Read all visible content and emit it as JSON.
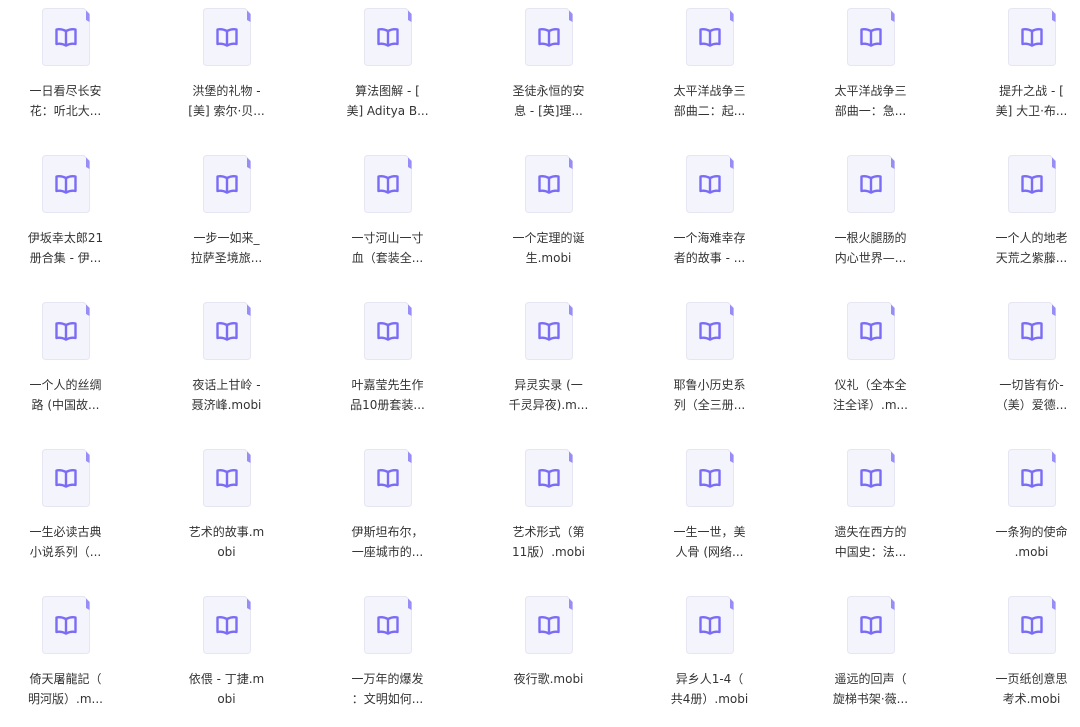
{
  "colors": {
    "icon_accent": "#7B6CF6",
    "icon_body": "#F4F4FD",
    "icon_border": "#E6E6F3",
    "icon_fold": "#8E82F5",
    "text": "#333333"
  },
  "icon": "ebook-book-icon",
  "files": [
    {
      "line1": "一日看尽长安",
      "line2": "花：听北大..."
    },
    {
      "line1": "洪堡的礼物 -",
      "line2": "[美] 索尔·贝..."
    },
    {
      "line1": "算法图解 - [",
      "line2": "美] Aditya B..."
    },
    {
      "line1": "圣徒永恒的安",
      "line2": "息 - [英]理..."
    },
    {
      "line1": "太平洋战争三",
      "line2": "部曲二：起..."
    },
    {
      "line1": "太平洋战争三",
      "line2": "部曲一：急..."
    },
    {
      "line1": "提升之战 - [",
      "line2": "美] 大卫·布..."
    },
    {
      "line1": "伊坂幸太郎21",
      "line2": "册合集 - 伊..."
    },
    {
      "line1": "一步一如来_",
      "line2": "拉萨圣境旅..."
    },
    {
      "line1": "一寸河山一寸",
      "line2": "血（套装全..."
    },
    {
      "line1": "一个定理的诞",
      "line2": "生.mobi"
    },
    {
      "line1": "一个海难幸存",
      "line2": "者的故事 - ..."
    },
    {
      "line1": "一根火腿肠的",
      "line2": "内心世界—..."
    },
    {
      "line1": "一个人的地老",
      "line2": "天荒之紫藤..."
    },
    {
      "line1": "一个人的丝绸",
      "line2": "路 (中国故..."
    },
    {
      "line1": "夜话上甘岭 -",
      "line2": "聂济峰.mobi"
    },
    {
      "line1": "叶嘉莹先生作",
      "line2": "品10册套装..."
    },
    {
      "line1": "异灵实录 (一",
      "line2": "千灵异夜).m..."
    },
    {
      "line1": "耶鲁小历史系",
      "line2": "列（全三册..."
    },
    {
      "line1": "仪礼（全本全",
      "line2": "注全译）.m..."
    },
    {
      "line1": "一切皆有价-",
      "line2": "（美）爱德..."
    },
    {
      "line1": "一生必读古典",
      "line2": "小说系列（..."
    },
    {
      "line1": "艺术的故事.m",
      "line2": "obi"
    },
    {
      "line1": "伊斯坦布尔，",
      "line2": "一座城市的..."
    },
    {
      "line1": "艺术形式（第",
      "line2": "11版）.mobi"
    },
    {
      "line1": "一生一世，美",
      "line2": "人骨 (网络..."
    },
    {
      "line1": "遗失在西方的",
      "line2": "中国史：法..."
    },
    {
      "line1": "一条狗的使命",
      "line2": ".mobi"
    },
    {
      "line1": "倚天屠龍記（",
      "line2": "明河版）.m..."
    },
    {
      "line1": "依偎 - 丁捷.m",
      "line2": "obi"
    },
    {
      "line1": "一万年的爆发",
      "line2": "：文明如何..."
    },
    {
      "line1": "夜行歌.mobi",
      "line2": ""
    },
    {
      "line1": "异乡人1-4（",
      "line2": "共4册）.mobi"
    },
    {
      "line1": "遥远的回声（",
      "line2": "旋梯书架·薇..."
    },
    {
      "line1": "一页纸创意思",
      "line2": "考术.mobi"
    }
  ]
}
